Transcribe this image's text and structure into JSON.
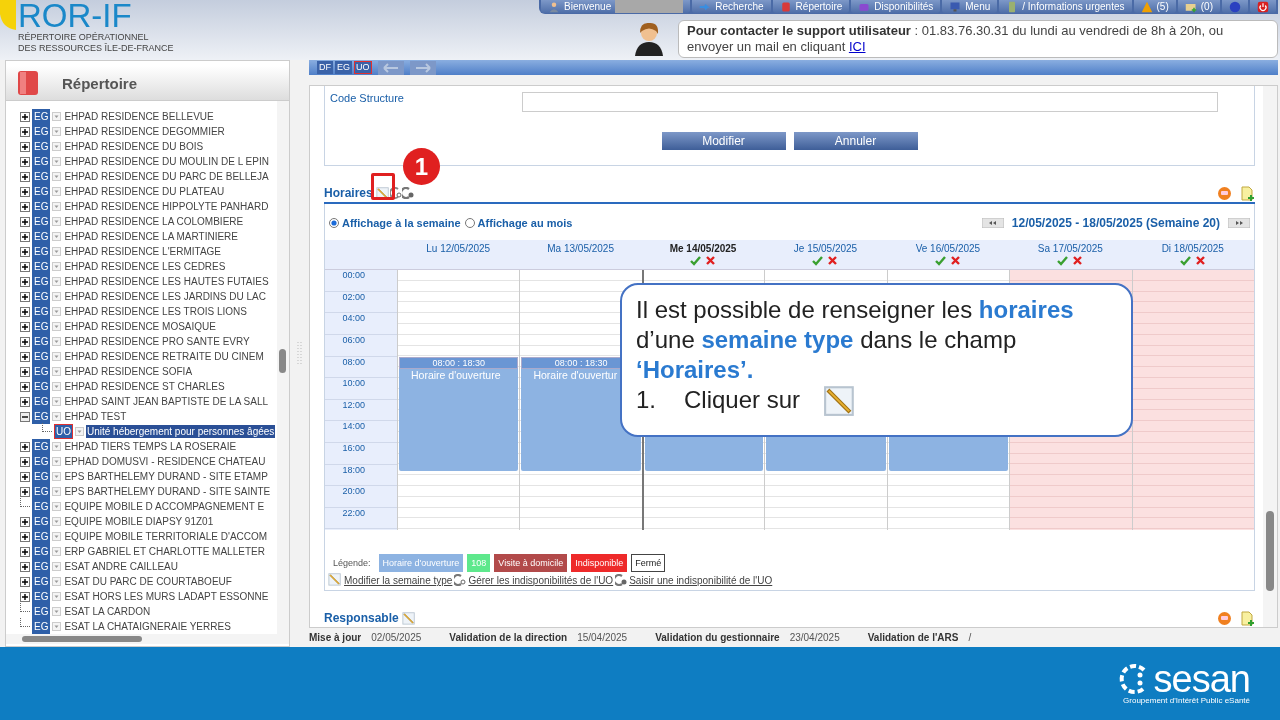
{
  "logo": {
    "name": "ROR-IF",
    "subtitle_lines": [
      "RÉPERTOIRE OPÉRATIONNEL",
      "DES RESSOURCES ÎLE-DE-FRANCE"
    ]
  },
  "nav": [
    {
      "kind": "user",
      "label": "Bienvenue"
    },
    {
      "kind": "search",
      "label": "Recherche"
    },
    {
      "kind": "book",
      "label": "Répertoire"
    },
    {
      "kind": "bed",
      "label": "Disponibilités"
    },
    {
      "kind": "monitor",
      "label": "Menu"
    },
    {
      "kind": "phone",
      "label": "/ Informations urgentes"
    },
    {
      "kind": "warning",
      "label": "(5)"
    },
    {
      "kind": "mail",
      "label": "(0)"
    },
    {
      "kind": "help"
    },
    {
      "kind": "power"
    }
  ],
  "support": {
    "text": "**Pour contacter le support utilisateur** : 01.83.76.30.31 du lundi au vendredi de 8h à 20h, ou envoyer un mail en cliquant ",
    "link": "ICI"
  },
  "sidebar": {
    "title": "Répertoire",
    "tree": [
      {
        "code": "EG",
        "label": "EHPAD RESIDENCE BELLEVUE",
        "kind": "branch",
        "expanded": false,
        "selected": false
      },
      {
        "code": "EG",
        "label": "EHPAD RESIDENCE DEGOMMIER",
        "kind": "branch",
        "expanded": false,
        "selected": false
      },
      {
        "code": "EG",
        "label": "EHPAD RESIDENCE DU BOIS",
        "kind": "branch",
        "expanded": false,
        "selected": false
      },
      {
        "code": "EG",
        "label": "EHPAD RESIDENCE DU MOULIN DE L EPIN",
        "kind": "branch",
        "expanded": false,
        "selected": false
      },
      {
        "code": "EG",
        "label": "EHPAD RESIDENCE DU PARC DE BELLEJA",
        "kind": "branch",
        "expanded": false,
        "selected": false
      },
      {
        "code": "EG",
        "label": "EHPAD RESIDENCE DU PLATEAU",
        "kind": "branch",
        "expanded": false,
        "selected": false
      },
      {
        "code": "EG",
        "label": "EHPAD RESIDENCE HIPPOLYTE PANHARD",
        "kind": "branch",
        "expanded": false,
        "selected": false
      },
      {
        "code": "EG",
        "label": "EHPAD RESIDENCE LA COLOMBIERE",
        "kind": "branch",
        "expanded": false,
        "selected": false
      },
      {
        "code": "EG",
        "label": "EHPAD RESIDENCE LA MARTINIERE",
        "kind": "branch",
        "expanded": false,
        "selected": false
      },
      {
        "code": "EG",
        "label": "EHPAD RESIDENCE L'ERMITAGE",
        "kind": "branch",
        "expanded": false,
        "selected": false
      },
      {
        "code": "EG",
        "label": "EHPAD RESIDENCE LES CEDRES",
        "kind": "branch",
        "expanded": false,
        "selected": false
      },
      {
        "code": "EG",
        "label": "EHPAD RESIDENCE LES HAUTES FUTAIES",
        "kind": "branch",
        "expanded": false,
        "selected": false
      },
      {
        "code": "EG",
        "label": "EHPAD RESIDENCE LES JARDINS DU LAC",
        "kind": "branch",
        "expanded": false,
        "selected": false
      },
      {
        "code": "EG",
        "label": "EHPAD RESIDENCE LES TROIS LIONS",
        "kind": "branch",
        "expanded": false,
        "selected": false
      },
      {
        "code": "EG",
        "label": "EHPAD RESIDENCE MOSAIQUE",
        "kind": "branch",
        "expanded": false,
        "selected": false
      },
      {
        "code": "EG",
        "label": "EHPAD RESIDENCE PRO SANTE EVRY",
        "kind": "branch",
        "expanded": false,
        "selected": false
      },
      {
        "code": "EG",
        "label": "EHPAD RESIDENCE RETRAITE DU CINEM",
        "kind": "branch",
        "expanded": false,
        "selected": false
      },
      {
        "code": "EG",
        "label": "EHPAD RESIDENCE SOFIA",
        "kind": "branch",
        "expanded": false,
        "selected": false
      },
      {
        "code": "EG",
        "label": "EHPAD RESIDENCE ST CHARLES",
        "kind": "branch",
        "expanded": false,
        "selected": false
      },
      {
        "code": "EG",
        "label": "EHPAD SAINT JEAN BAPTISTE DE LA SALL",
        "kind": "branch",
        "expanded": false,
        "selected": false
      },
      {
        "code": "EG",
        "label": "EHPAD TEST",
        "kind": "branch",
        "expanded": true,
        "selected": false,
        "children": [
          {
            "code": "UO",
            "label": "Unité hébergement pour personnes âgées",
            "kind": "leaf",
            "selected": true
          }
        ]
      },
      {
        "code": "EG",
        "label": "EHPAD TIERS TEMPS LA ROSERAIE",
        "kind": "branch",
        "expanded": false,
        "selected": false
      },
      {
        "code": "EG",
        "label": "EPHAD DOMUSVI - RESIDENCE CHATEAU",
        "kind": "branch",
        "expanded": false,
        "selected": false
      },
      {
        "code": "EG",
        "label": "EPS BARTHELEMY DURAND - SITE ETAMP",
        "kind": "branch",
        "expanded": false,
        "selected": false
      },
      {
        "code": "EG",
        "label": "EPS BARTHELEMY DURAND - SITE SAINTE",
        "kind": "branch",
        "expanded": false,
        "selected": false
      },
      {
        "code": "EG",
        "label": "EQUIPE MOBILE D ACCOMPAGNEMENT E",
        "kind": "leaf",
        "selected": false
      },
      {
        "code": "EG",
        "label": "EQUIPE MOBILE DIAPSY 91Z01",
        "kind": "branch",
        "expanded": false,
        "selected": false
      },
      {
        "code": "EG",
        "label": "EQUIPE MOBILE TERRITORIALE D'ACCOM",
        "kind": "branch",
        "expanded": false,
        "selected": false
      },
      {
        "code": "EG",
        "label": "ERP GABRIEL ET CHARLOTTE MALLETER",
        "kind": "branch",
        "expanded": false,
        "selected": false
      },
      {
        "code": "EG",
        "label": "ESAT ANDRE CAILLEAU",
        "kind": "branch",
        "expanded": false,
        "selected": false
      },
      {
        "code": "EG",
        "label": "ESAT DU PARC DE COURTABOEUF",
        "kind": "branch",
        "expanded": false,
        "selected": false
      },
      {
        "code": "EG",
        "label": "ESAT HORS LES MURS LADAPT ESSONNE",
        "kind": "branch",
        "expanded": false,
        "selected": false
      },
      {
        "code": "EG",
        "label": "ESAT LA CARDON",
        "kind": "leaf",
        "selected": false
      },
      {
        "code": "EG",
        "label": "ESAT LA CHATAIGNERAIE YERRES",
        "kind": "leaf",
        "selected": false
      }
    ]
  },
  "toolbar": {
    "levels": [
      {
        "label": "DF",
        "selected": false
      },
      {
        "label": "EG",
        "selected": false
      },
      {
        "label": "UO",
        "selected": true
      }
    ]
  },
  "form": {
    "field_label": "Code Structure",
    "buttons": [
      "Modifier",
      "Annuler"
    ]
  },
  "horaires": {
    "title": "Horaires",
    "callout_number": "1",
    "views": [
      {
        "label": "Affichage à la semaine",
        "selected": true
      },
      {
        "label": "Affichage au mois",
        "selected": false
      }
    ],
    "week": "12/05/2025 - 18/05/2025 (Semaine 20)",
    "hours": [
      "00:00",
      "02:00",
      "04:00",
      "06:00",
      "08:00",
      "10:00",
      "12:00",
      "14:00",
      "16:00",
      "18:00",
      "20:00",
      "22:00"
    ],
    "days": [
      {
        "label": "Lu 12/05/2025",
        "today": false,
        "actions": false,
        "closed": false,
        "event": {
          "kind": "opening",
          "time": "08:00 : 18:30",
          "label": "Horaire d'ouverture"
        }
      },
      {
        "label": "Ma 13/05/2025",
        "today": false,
        "actions": false,
        "closed": false,
        "event": {
          "kind": "opening",
          "time": "08:00 : 18:30",
          "label": "Horaire d'ouvertur"
        }
      },
      {
        "label": "Me 14/05/2025",
        "today": true,
        "actions": true,
        "closed": false,
        "event": {
          "kind": "opening"
        }
      },
      {
        "label": "Je 15/05/2025",
        "today": false,
        "actions": true,
        "closed": false,
        "event": {
          "kind": "opening"
        }
      },
      {
        "label": "Ve 16/05/2025",
        "today": false,
        "actions": true,
        "closed": false,
        "event": {
          "kind": "opening"
        }
      },
      {
        "label": "Sa 17/05/2025",
        "today": false,
        "actions": true,
        "closed": true
      },
      {
        "label": "Di 18/05/2025",
        "today": false,
        "actions": true,
        "closed": true
      }
    ],
    "legend_title": "Légende:",
    "legend": [
      {
        "label": "Horaire d'ouverture",
        "color": "#8db3e2"
      },
      {
        "label": "108",
        "color": "#5ee88c"
      },
      {
        "label": "Visite à domicile",
        "color": "#b24a4a"
      },
      {
        "label": "Indisponible",
        "color": "#ee2a2a"
      },
      {
        "label": "Fermé",
        "color": "#ffffff"
      }
    ],
    "links": [
      {
        "kind": "edit",
        "label": "Modifier la semaine type"
      },
      {
        "kind": "manage",
        "label": "Gérer les indisponibilités de l'UO"
      },
      {
        "kind": "add",
        "label": "Saisir une indisponibilité de l'UO"
      }
    ]
  },
  "responsable": {
    "title": "Responsable"
  },
  "footer": [
    {
      "label": "Mise à jour",
      "value": "02/05/2025"
    },
    {
      "label": "Validation de la direction",
      "value": "15/04/2025"
    },
    {
      "label": "Validation du gestionnaire",
      "value": "23/04/2025"
    },
    {
      "label": "Validation de l'ARS",
      "value": "/"
    }
  ],
  "tip": {
    "text": "Il est possible de renseigner les **horaires** d’une **semaine type** dans le champ **‘Horaires’.**",
    "step_number": "1.",
    "step_text": "Cliquer sur"
  },
  "brand": {
    "name": "sesan",
    "tagline": "Groupement d'Intérêt Public eSanté"
  }
}
